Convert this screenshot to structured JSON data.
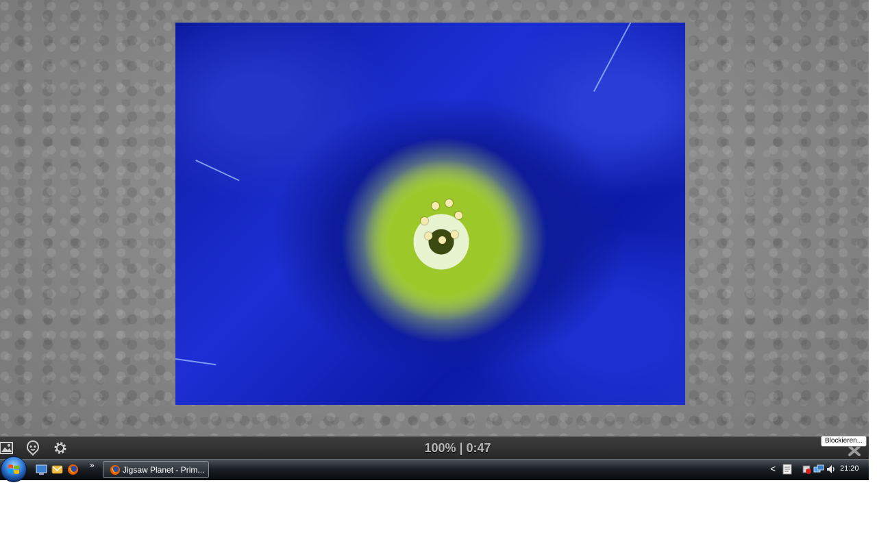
{
  "game": {
    "progress_text": "100% | 0:47",
    "tooltip": "Blockieren..."
  },
  "toolbar": {
    "icons": [
      "image-preview-icon",
      "ghost-image-icon",
      "settings-gear-icon"
    ]
  },
  "taskbar": {
    "quick_launch": [
      "show-desktop-icon",
      "mail-icon",
      "firefox-icon"
    ],
    "overflow_symbol": "»",
    "active_task": "Jigsaw Planet - Prim...",
    "tray_expand_symbol": "<",
    "tray_icons": [
      "notes-icon",
      "usb-device-icon",
      "network-icon",
      "volume-icon"
    ],
    "clock": "21:20"
  },
  "colors": {
    "flower_blue": "#1a2ec8",
    "flower_center": "#d8ff60",
    "toolbar_bg": "#2f2f2f",
    "taskbar_bg": "#111519"
  }
}
